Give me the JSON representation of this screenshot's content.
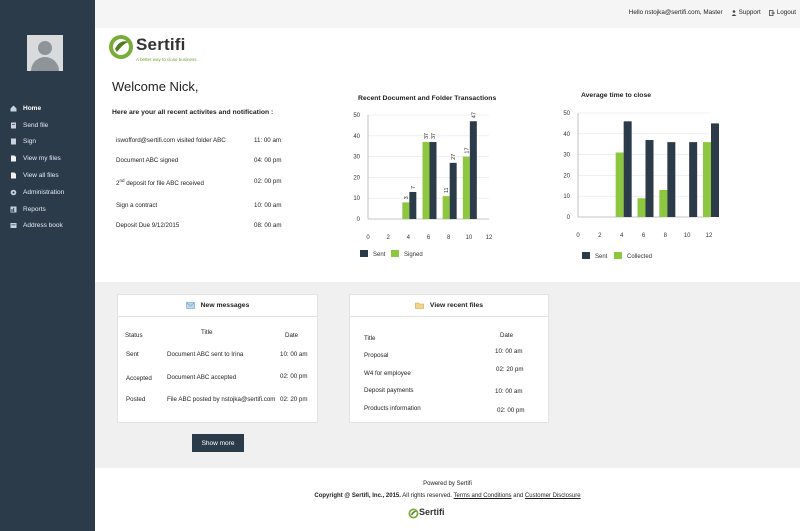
{
  "topbar": {
    "greeting": "Hello nstojka@sertifi.com, Master",
    "support": "Support",
    "logout": "Logout"
  },
  "brand": {
    "name": "Sertifi",
    "tagline": "A better way to close business.",
    "green": "#7aac3a",
    "navy": "#2b3b4a"
  },
  "sidebar": {
    "items": [
      {
        "label": "Home",
        "icon": "home-icon",
        "active": true
      },
      {
        "label": "Send file",
        "icon": "send-file-icon",
        "active": false
      },
      {
        "label": "Sign",
        "icon": "sign-icon",
        "active": false
      },
      {
        "label": "View my files",
        "icon": "my-files-icon",
        "active": false
      },
      {
        "label": "View all files",
        "icon": "all-files-icon",
        "active": false
      },
      {
        "label": "Administration",
        "icon": "gear-icon",
        "active": false
      },
      {
        "label": "Reports",
        "icon": "reports-icon",
        "active": false
      },
      {
        "label": "Address book",
        "icon": "address-book-icon",
        "active": false
      }
    ]
  },
  "main": {
    "welcome": "Welcome Nick,",
    "subtitle": "Here are your all recent activites and notification :",
    "activities": [
      {
        "text": "iswofford@sertifi.com visited folder ABC",
        "time": "11: 00 am"
      },
      {
        "text": "Document ABC signed",
        "time": "04: 00 pm"
      },
      {
        "text_sup": "nd",
        "text_pre": "2",
        "text_post": " deposit for file ABC received",
        "time": "02: 00 pm"
      },
      {
        "text": "Sign a contract",
        "time": "10: 00 am"
      },
      {
        "text": "Deposit Due 9/12/2015",
        "time": "08: 00 am"
      }
    ]
  },
  "chart_data": [
    {
      "type": "bar",
      "title": "Recent Document and Folder Transactions",
      "x": [
        4,
        6,
        8,
        10
      ],
      "x_ticks": [
        0,
        2,
        4,
        6,
        8,
        10,
        12
      ],
      "y_ticks": [
        0,
        10,
        20,
        30,
        40,
        50
      ],
      "ylim": [
        0,
        50
      ],
      "grid": true,
      "legend": "bottom",
      "series": [
        {
          "name": "Sent",
          "color": "#2b3b4a",
          "values": [
            13,
            37,
            27,
            47
          ],
          "labels": [
            "7",
            "37",
            "27",
            "47"
          ]
        },
        {
          "name": "Signed",
          "color": "#8dc63f",
          "values": [
            8,
            37,
            11,
            30
          ],
          "labels": [
            "3",
            "37",
            "11",
            "17"
          ]
        }
      ]
    },
    {
      "type": "bar",
      "title": "Average time to close",
      "x": [
        4,
        6,
        8,
        10,
        12
      ],
      "x_ticks": [
        0,
        2,
        4,
        6,
        8,
        10,
        12
      ],
      "y_ticks": [
        0,
        10,
        20,
        30,
        40,
        50
      ],
      "ylim": [
        0,
        50
      ],
      "grid": true,
      "legend": "bottom",
      "series": [
        {
          "name": "Sent",
          "color": "#2b3b4a",
          "values": [
            46,
            37,
            36,
            36,
            45
          ]
        },
        {
          "name": "Collected",
          "color": "#8dc63f",
          "values": [
            31,
            9,
            13,
            0,
            36
          ]
        }
      ]
    }
  ],
  "messages": {
    "title": "New messages",
    "headers": {
      "status": "Status",
      "title": "Title",
      "date": "Date"
    },
    "rows": [
      {
        "status": "Sent",
        "title": "Document ABC sent to Irina",
        "date": "10: 00 am"
      },
      {
        "status": "Accepted",
        "title": "Document ABC accepted",
        "date": "02: 00 pm"
      },
      {
        "status": "Posted",
        "title": "File ABC posted by nstojka@sertifi.com",
        "date": "02: 20 pm"
      }
    ],
    "show_more": "Show more"
  },
  "files": {
    "title": "View recent files",
    "headers": {
      "title": "Title",
      "date": "Date"
    },
    "rows": [
      {
        "title": "Proposal",
        "date": "10: 00 am"
      },
      {
        "title": "W4 for employee",
        "date": "02: 20 pm"
      },
      {
        "title": "Deposit payments",
        "date": "10: 00 am"
      },
      {
        "title": "Products information",
        "date": "02: 00 pm"
      }
    ]
  },
  "footer": {
    "powered": "Powered by Sertifi",
    "copyright": "Copyright @ Sertifi, Inc., 2015.",
    "rights": " All rights reserved. ",
    "terms": "Terms and Conditions",
    "and": " and ",
    "disclosure": "Customer Disclosure",
    "logo_text": "Sertifi"
  }
}
